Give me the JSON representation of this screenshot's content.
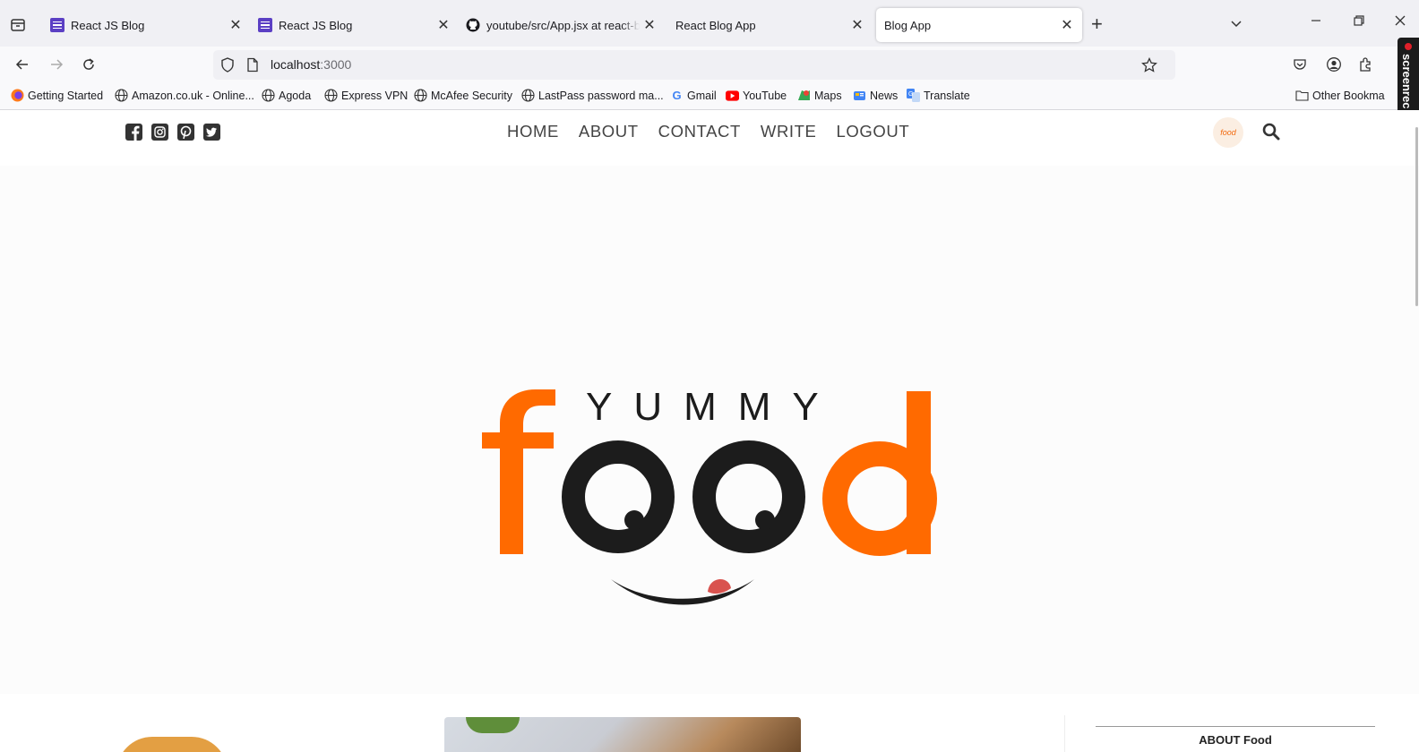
{
  "browser": {
    "tabs": [
      {
        "title": "React JS Blog",
        "favicon": "purple-list-icon",
        "active": false
      },
      {
        "title": "React JS Blog",
        "favicon": "purple-list-icon",
        "active": false
      },
      {
        "title": "youtube/src/App.jsx at react-bl",
        "favicon": "github-icon",
        "active": false
      },
      {
        "title": "React Blog App",
        "favicon": "none",
        "active": false
      },
      {
        "title": "Blog App",
        "favicon": "none",
        "active": true
      }
    ],
    "url": {
      "host": "localhost",
      "port": ":3000"
    },
    "bookmarks": [
      {
        "label": "Getting Started",
        "icon": "firefox-icon"
      },
      {
        "label": "Amazon.co.uk - Online...",
        "icon": "globe-icon"
      },
      {
        "label": "Agoda",
        "icon": "globe-icon"
      },
      {
        "label": "Express VPN",
        "icon": "globe-icon"
      },
      {
        "label": "McAfee Security",
        "icon": "globe-icon"
      },
      {
        "label": "LastPass password ma...",
        "icon": "globe-icon"
      },
      {
        "label": "Gmail",
        "icon": "google-icon"
      },
      {
        "label": "YouTube",
        "icon": "youtube-icon"
      },
      {
        "label": "Maps",
        "icon": "maps-icon"
      },
      {
        "label": "News",
        "icon": "news-icon"
      },
      {
        "label": "Translate",
        "icon": "translate-icon"
      }
    ],
    "other_bookmarks": "Other Bookma",
    "screen_recorder": "screenrec"
  },
  "site": {
    "nav": [
      "HOME",
      "ABOUT",
      "CONTACT",
      "WRITE",
      "LOGOUT"
    ],
    "avatar_text": "food",
    "logo": {
      "top_text": "YUMMY",
      "main_text": "food"
    },
    "sidebar_title": "ABOUT Food"
  },
  "colors": {
    "brand_orange": "#ff6a00",
    "logo_dark": "#1c1c1c"
  }
}
